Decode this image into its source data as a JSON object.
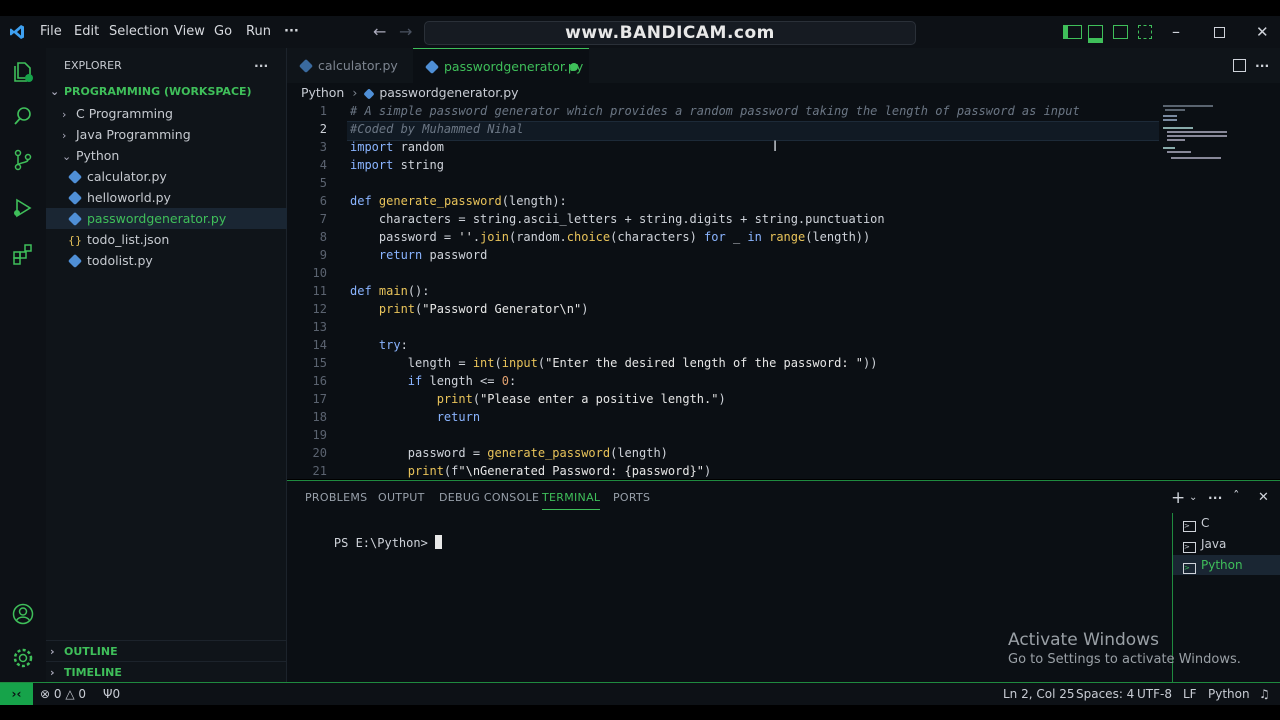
{
  "titlebar": {
    "menu": [
      "File",
      "Edit",
      "Selection",
      "View",
      "Go",
      "Run",
      "···"
    ],
    "command_center": "www.BANDICAM.com"
  },
  "sidebar": {
    "header": "EXPLORER",
    "workspace": "PROGRAMMING (WORKSPACE)",
    "items": [
      {
        "label": "C Programming",
        "type": "folder",
        "expanded": false
      },
      {
        "label": "Java Programming",
        "type": "folder",
        "expanded": false
      },
      {
        "label": "Python",
        "type": "folder",
        "expanded": true
      },
      {
        "label": "calculator.py",
        "type": "py"
      },
      {
        "label": "helloworld.py",
        "type": "py"
      },
      {
        "label": "passwordgenerator.py",
        "type": "py",
        "selected": true
      },
      {
        "label": "todo_list.json",
        "type": "json"
      },
      {
        "label": "todolist.py",
        "type": "py"
      }
    ],
    "outline": "OUTLINE",
    "timeline": "TIMELINE"
  },
  "editor": {
    "tabs": [
      {
        "label": "calculator.py",
        "active": false
      },
      {
        "label": "passwordgenerator.py",
        "active": true,
        "dirty": true
      }
    ],
    "breadcrumb": [
      "Python",
      "passwordgenerator.py"
    ],
    "lines": [
      "# A simple password generator which provides a random password taking the length of password as input",
      "#Coded by Muhammed Nihal",
      "import random",
      "import string",
      "",
      "def generate_password(length):",
      "    characters = string.ascii_letters + string.digits + string.punctuation",
      "    password = ''.join(random.choice(characters) for _ in range(length))",
      "    return password",
      "",
      "def main():",
      "    print(\"Password Generator\\n\")",
      "",
      "    try:",
      "        length = int(input(\"Enter the desired length of the password: \"))",
      "        if length <= 0:",
      "            print(\"Please enter a positive length.\")",
      "            return",
      "",
      "        password = generate_password(length)",
      "        print(f\"\\nGenerated Password: {password}\")"
    ]
  },
  "panel": {
    "tabs": [
      "PROBLEMS",
      "OUTPUT",
      "DEBUG CONSOLE",
      "TERMINAL",
      "PORTS"
    ],
    "active_tab": "TERMINAL",
    "prompt": "PS E:\\Python> ",
    "terminals": [
      "C",
      "Java",
      "Python"
    ],
    "active_terminal": "Python"
  },
  "statusbar": {
    "errors": "0",
    "warnings": "0",
    "ports": "0",
    "position": "Ln 2, Col 25",
    "spaces": "Spaces: 4",
    "encoding": "UTF-8",
    "eol": "LF",
    "language": "Python"
  },
  "watermark": {
    "title": "Activate Windows",
    "subtitle": "Go to Settings to activate Windows."
  },
  "colors": {
    "accent": "#1f8a3f",
    "status_remote": "#16a34a"
  }
}
